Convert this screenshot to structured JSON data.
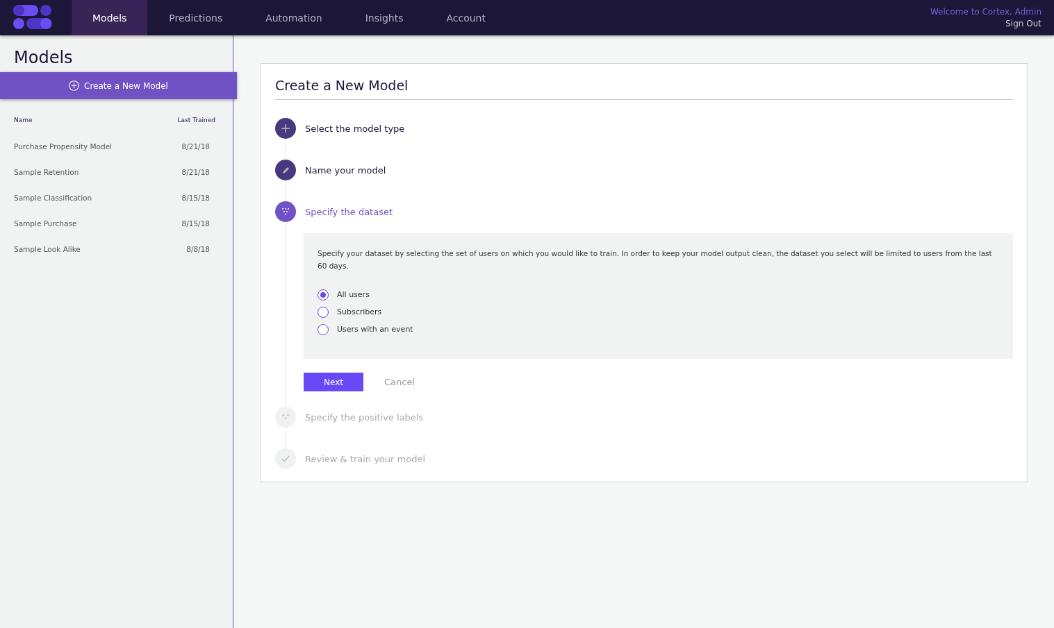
{
  "nav": {
    "tabs": [
      {
        "label": "Models",
        "selected": true
      },
      {
        "label": "Predictions",
        "selected": false
      },
      {
        "label": "Automation",
        "selected": false
      },
      {
        "label": "Insights",
        "selected": false
      },
      {
        "label": "Account",
        "selected": false
      }
    ],
    "welcome": "Welcome to Cortex, Admin",
    "sign_out": "Sign Out"
  },
  "sidebar": {
    "title": "Models",
    "create_button": "Create a New Model",
    "columns": [
      "Name",
      "Last Trained"
    ],
    "rows": [
      {
        "name": "Purchase Propensity Model",
        "date": "8/21/18"
      },
      {
        "name": "Sample Retention",
        "date": "8/21/18"
      },
      {
        "name": "Sample Classification",
        "date": "8/15/18"
      },
      {
        "name": "Sample Purchase",
        "date": "8/15/18"
      },
      {
        "name": "Sample Look Alike",
        "date": "8/8/18"
      }
    ]
  },
  "card": {
    "title": "Create a New Model",
    "steps": [
      {
        "kind": "plus",
        "completed": true,
        "selected": false,
        "label": "Select the model type"
      },
      {
        "kind": "pencil",
        "completed": true,
        "selected": false,
        "label": "Name your model"
      },
      {
        "kind": "dataset",
        "completed": false,
        "selected": true,
        "label": "Specify the dataset",
        "panel": {
          "description": "Specify your dataset by selecting the set of users on which you would like to train. In order to keep your model output clean, the dataset you select will be limited to users from the last 60 days.",
          "options": [
            {
              "label": "All users",
              "selected": true
            },
            {
              "label": "Subscribers",
              "selected": false
            },
            {
              "label": "Users with an event",
              "selected": false
            }
          ],
          "next": "Next",
          "cancel": "Cancel"
        }
      },
      {
        "kind": "dots",
        "completed": false,
        "selected": false,
        "label": "Specify the positive labels"
      },
      {
        "kind": "check",
        "completed": false,
        "selected": false,
        "label": "Review & train your model"
      }
    ]
  }
}
